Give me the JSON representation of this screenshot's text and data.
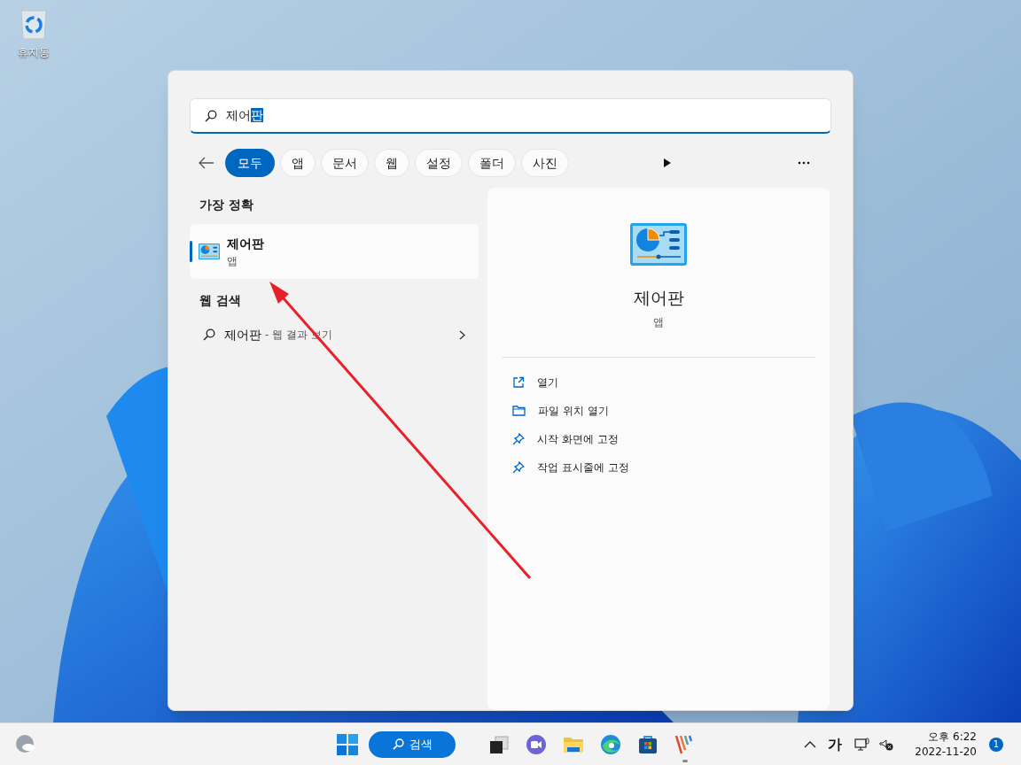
{
  "desktop_icons": [
    {
      "label": "휴지통"
    }
  ],
  "search": {
    "query": "제어",
    "selected_text": "판"
  },
  "filters": [
    {
      "label": "모두",
      "selected": true
    },
    {
      "label": "앱",
      "selected": false
    },
    {
      "label": "문서",
      "selected": false
    },
    {
      "label": "웹",
      "selected": false
    },
    {
      "label": "설정",
      "selected": false
    },
    {
      "label": "폴더",
      "selected": false
    },
    {
      "label": "사진",
      "selected": false
    }
  ],
  "best_match": {
    "heading": "가장 정확",
    "items": [
      {
        "title": "제어판",
        "subtitle": "앱",
        "selected": true
      }
    ]
  },
  "web_search": {
    "heading": "웹 검색",
    "items": [
      {
        "query": "제어판",
        "suffix": "- 웹 결과 보기"
      }
    ]
  },
  "detail": {
    "title": "제어판",
    "subtitle": "앱",
    "actions": [
      {
        "kind": "open",
        "label": "열기"
      },
      {
        "kind": "folder",
        "label": "파일 위치 열기"
      },
      {
        "kind": "pin",
        "label": "시작 화면에 고정"
      },
      {
        "kind": "pin",
        "label": "작업 표시줄에 고정"
      }
    ]
  },
  "taskbar": {
    "search_label": "검색",
    "apps": [
      {
        "kind": "taskview",
        "running": false
      },
      {
        "kind": "chat",
        "running": false
      },
      {
        "kind": "files",
        "running": false
      },
      {
        "kind": "browser",
        "running": false
      },
      {
        "kind": "store",
        "running": false
      },
      {
        "kind": "stripes",
        "running": true
      }
    ],
    "ime": "가",
    "time": "오후 6:22",
    "date": "2022-11-20",
    "notifications": "1"
  }
}
